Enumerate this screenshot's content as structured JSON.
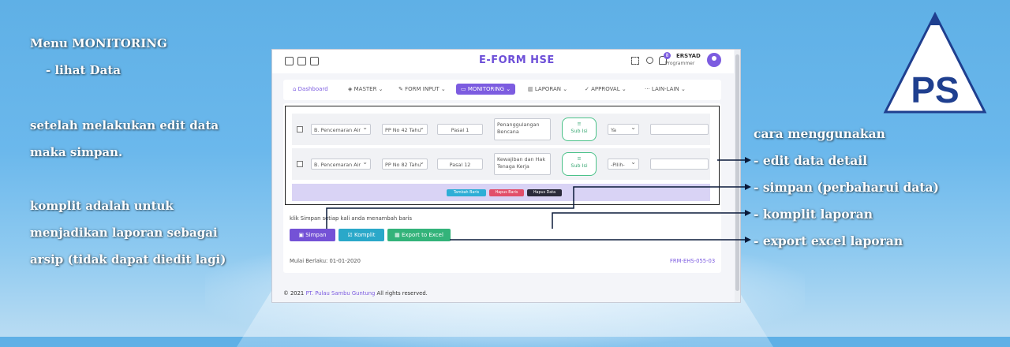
{
  "left_notes": {
    "l1": "Menu MONITORING",
    "l2": "- lihat Data",
    "l3": "setelah melakukan edit data",
    "l4": "maka simpan.",
    "l5": "komplit adalah untuk",
    "l6": "menjadikan laporan sebagai",
    "l7": "arsip (tidak dapat diedit lagi)"
  },
  "right_notes": {
    "title": "cara menggunakan",
    "item1": "- edit data detail",
    "item2": "- simpan (perbaharui data)",
    "item3": "- komplit laporan",
    "item4": "- export excel laporan"
  },
  "logo": {
    "text": "PS",
    "color": "#1f3f8f"
  },
  "app": {
    "title": "E-FORM HSE",
    "user_name": "ERSYAD",
    "user_role": "Programmer",
    "notif_count": "8",
    "accent": "#7c5ce0"
  },
  "nav": {
    "dashboard": "Dashboard",
    "master": "MASTER ⌄",
    "form_input": "FORM INPUT ⌄",
    "monitoring": "MONITORING ⌄",
    "laporan": "LAPORAN ⌄",
    "approval": "APPROVAL ⌄",
    "lain": "LAIN-LAIN ⌄"
  },
  "rows": [
    {
      "kategori": "B. Pencemaran Air",
      "peraturan": "PP No 42 Tahu",
      "pasal": "Pasal 1",
      "uraian": "Penanggulangan Bencana",
      "subisi": "Sub Isi",
      "status": "Ya"
    },
    {
      "kategori": "B. Pencemaran Air",
      "peraturan": "PP No 82 Tahu",
      "pasal": "Pasal 12",
      "uraian": "Kewajiban dan Hak Tenaga Kerja",
      "subisi": "Sub Isi",
      "status": "-Pilih-"
    }
  ],
  "row_buttons": {
    "tambah": "Tambah Baris",
    "hapus_baris": "Hapus Baris",
    "hapus_data": "Hapus Data"
  },
  "hint": "klik Simpan setiap kali anda menambah baris",
  "actions": {
    "simpan": "Simpan",
    "komplit": "Komplit",
    "export": "Export to Excel"
  },
  "footer": {
    "berlaku": "Mulai Berlaku: 01-01-2020",
    "form_code": "FRM-EHS-055-03",
    "copyright": "© 2021",
    "company": "PT. Pulau Sambu Guntung",
    "rights": "All rights reserved."
  }
}
